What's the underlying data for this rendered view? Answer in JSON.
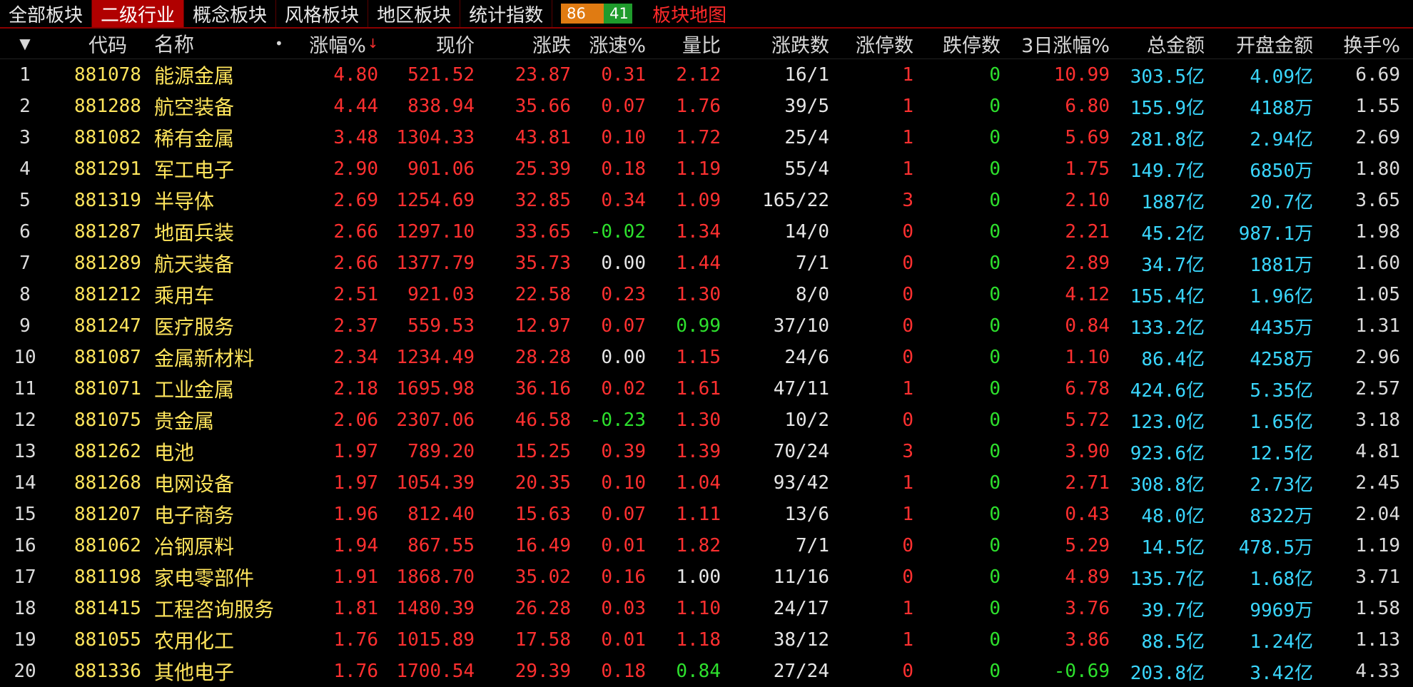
{
  "tabs": [
    {
      "label": "全部板块",
      "active": false
    },
    {
      "label": "二级行业",
      "active": true
    },
    {
      "label": "概念板块",
      "active": false
    },
    {
      "label": "风格板块",
      "active": false
    },
    {
      "label": "地区板块",
      "active": false
    },
    {
      "label": "统计指数",
      "active": false
    }
  ],
  "updown": {
    "up": "86",
    "down": "41"
  },
  "map_link": "板块地图",
  "header": {
    "menu": "▼",
    "code": "代码",
    "name": "名称",
    "dot": "•",
    "chg": "涨幅%",
    "price": "现价",
    "diff": "涨跌",
    "speed": "涨速%",
    "vr": "量比",
    "ud": "涨跌数",
    "lu": "涨停数",
    "ld": "跌停数",
    "d3": "3日涨幅%",
    "amt": "总金额",
    "open": "开盘金额",
    "turn": "换手%"
  },
  "rows": [
    {
      "idx": "1",
      "code": "881078",
      "name": "能源金属",
      "chg": "4.80",
      "price": "521.52",
      "diff": "23.87",
      "speed": "0.31",
      "vr": "2.12",
      "ud": "16/1",
      "lu": "1",
      "ld": "0",
      "d3": "10.99",
      "amt": "303.5亿",
      "open": "4.09亿",
      "turn": "6.69"
    },
    {
      "idx": "2",
      "code": "881288",
      "name": "航空装备",
      "chg": "4.44",
      "price": "838.94",
      "diff": "35.66",
      "speed": "0.07",
      "vr": "1.76",
      "ud": "39/5",
      "lu": "1",
      "ld": "0",
      "d3": "6.80",
      "amt": "155.9亿",
      "open": "4188万",
      "turn": "1.55"
    },
    {
      "idx": "3",
      "code": "881082",
      "name": "稀有金属",
      "chg": "3.48",
      "price": "1304.33",
      "diff": "43.81",
      "speed": "0.10",
      "vr": "1.72",
      "ud": "25/4",
      "lu": "1",
      "ld": "0",
      "d3": "5.69",
      "amt": "281.8亿",
      "open": "2.94亿",
      "turn": "2.69"
    },
    {
      "idx": "4",
      "code": "881291",
      "name": "军工电子",
      "chg": "2.90",
      "price": "901.06",
      "diff": "25.39",
      "speed": "0.18",
      "vr": "1.19",
      "ud": "55/4",
      "lu": "1",
      "ld": "0",
      "d3": "1.75",
      "amt": "149.7亿",
      "open": "6850万",
      "turn": "1.80"
    },
    {
      "idx": "5",
      "code": "881319",
      "name": "半导体",
      "chg": "2.69",
      "price": "1254.69",
      "diff": "32.85",
      "speed": "0.34",
      "vr": "1.09",
      "ud": "165/22",
      "lu": "3",
      "ld": "0",
      "d3": "2.10",
      "amt": "1887亿",
      "open": "20.7亿",
      "turn": "3.65"
    },
    {
      "idx": "6",
      "code": "881287",
      "name": "地面兵装",
      "chg": "2.66",
      "price": "1297.10",
      "diff": "33.65",
      "speed": "-0.02",
      "vr": "1.34",
      "ud": "14/0",
      "lu": "0",
      "ld": "0",
      "d3": "2.21",
      "amt": "45.2亿",
      "open": "987.1万",
      "turn": "1.98"
    },
    {
      "idx": "7",
      "code": "881289",
      "name": "航天装备",
      "chg": "2.66",
      "price": "1377.79",
      "diff": "35.73",
      "speed": "0.00",
      "vr": "1.44",
      "ud": "7/1",
      "lu": "0",
      "ld": "0",
      "d3": "2.89",
      "amt": "34.7亿",
      "open": "1881万",
      "turn": "1.60"
    },
    {
      "idx": "8",
      "code": "881212",
      "name": "乘用车",
      "chg": "2.51",
      "price": "921.03",
      "diff": "22.58",
      "speed": "0.23",
      "vr": "1.30",
      "ud": "8/0",
      "lu": "0",
      "ld": "0",
      "d3": "4.12",
      "amt": "155.4亿",
      "open": "1.96亿",
      "turn": "1.05"
    },
    {
      "idx": "9",
      "code": "881247",
      "name": "医疗服务",
      "chg": "2.37",
      "price": "559.53",
      "diff": "12.97",
      "speed": "0.07",
      "vr": "0.99",
      "ud": "37/10",
      "lu": "0",
      "ld": "0",
      "d3": "0.84",
      "amt": "133.2亿",
      "open": "4435万",
      "turn": "1.31"
    },
    {
      "idx": "10",
      "code": "881087",
      "name": "金属新材料",
      "chg": "2.34",
      "price": "1234.49",
      "diff": "28.28",
      "speed": "0.00",
      "vr": "1.15",
      "ud": "24/6",
      "lu": "0",
      "ld": "0",
      "d3": "1.10",
      "amt": "86.4亿",
      "open": "4258万",
      "turn": "2.96"
    },
    {
      "idx": "11",
      "code": "881071",
      "name": "工业金属",
      "chg": "2.18",
      "price": "1695.98",
      "diff": "36.16",
      "speed": "0.02",
      "vr": "1.61",
      "ud": "47/11",
      "lu": "1",
      "ld": "0",
      "d3": "6.78",
      "amt": "424.6亿",
      "open": "5.35亿",
      "turn": "2.57"
    },
    {
      "idx": "12",
      "code": "881075",
      "name": "贵金属",
      "chg": "2.06",
      "price": "2307.06",
      "diff": "46.58",
      "speed": "-0.23",
      "vr": "1.30",
      "ud": "10/2",
      "lu": "0",
      "ld": "0",
      "d3": "5.72",
      "amt": "123.0亿",
      "open": "1.65亿",
      "turn": "3.18"
    },
    {
      "idx": "13",
      "code": "881262",
      "name": "电池",
      "chg": "1.97",
      "price": "789.20",
      "diff": "15.25",
      "speed": "0.39",
      "vr": "1.39",
      "ud": "70/24",
      "lu": "3",
      "ld": "0",
      "d3": "3.90",
      "amt": "923.6亿",
      "open": "12.5亿",
      "turn": "4.81"
    },
    {
      "idx": "14",
      "code": "881268",
      "name": "电网设备",
      "chg": "1.97",
      "price": "1054.39",
      "diff": "20.35",
      "speed": "0.10",
      "vr": "1.04",
      "ud": "93/42",
      "lu": "1",
      "ld": "0",
      "d3": "2.71",
      "amt": "308.8亿",
      "open": "2.73亿",
      "turn": "2.45"
    },
    {
      "idx": "15",
      "code": "881207",
      "name": "电子商务",
      "chg": "1.96",
      "price": "812.40",
      "diff": "15.63",
      "speed": "0.07",
      "vr": "1.11",
      "ud": "13/6",
      "lu": "1",
      "ld": "0",
      "d3": "0.43",
      "amt": "48.0亿",
      "open": "8322万",
      "turn": "2.04"
    },
    {
      "idx": "16",
      "code": "881062",
      "name": "冶钢原料",
      "chg": "1.94",
      "price": "867.55",
      "diff": "16.49",
      "speed": "0.01",
      "vr": "1.82",
      "ud": "7/1",
      "lu": "0",
      "ld": "0",
      "d3": "5.29",
      "amt": "14.5亿",
      "open": "478.5万",
      "turn": "1.19"
    },
    {
      "idx": "17",
      "code": "881198",
      "name": "家电零部件",
      "chg": "1.91",
      "price": "1868.70",
      "diff": "35.02",
      "speed": "0.16",
      "vr": "1.00",
      "ud": "11/16",
      "lu": "0",
      "ld": "0",
      "d3": "4.89",
      "amt": "135.7亿",
      "open": "1.68亿",
      "turn": "3.71"
    },
    {
      "idx": "18",
      "code": "881415",
      "name": "工程咨询服务",
      "chg": "1.81",
      "price": "1480.39",
      "diff": "26.28",
      "speed": "0.03",
      "vr": "1.10",
      "ud": "24/17",
      "lu": "1",
      "ld": "0",
      "d3": "3.76",
      "amt": "39.7亿",
      "open": "9969万",
      "turn": "1.58"
    },
    {
      "idx": "19",
      "code": "881055",
      "name": "农用化工",
      "chg": "1.76",
      "price": "1015.89",
      "diff": "17.58",
      "speed": "0.01",
      "vr": "1.18",
      "ud": "38/12",
      "lu": "1",
      "ld": "0",
      "d3": "3.86",
      "amt": "88.5亿",
      "open": "1.24亿",
      "turn": "1.13"
    },
    {
      "idx": "20",
      "code": "881336",
      "name": "其他电子",
      "chg": "1.76",
      "price": "1700.54",
      "diff": "29.39",
      "speed": "0.18",
      "vr": "0.84",
      "ud": "27/24",
      "lu": "0",
      "ld": "0",
      "d3": "-0.69",
      "amt": "203.8亿",
      "open": "3.42亿",
      "turn": "4.33"
    }
  ]
}
